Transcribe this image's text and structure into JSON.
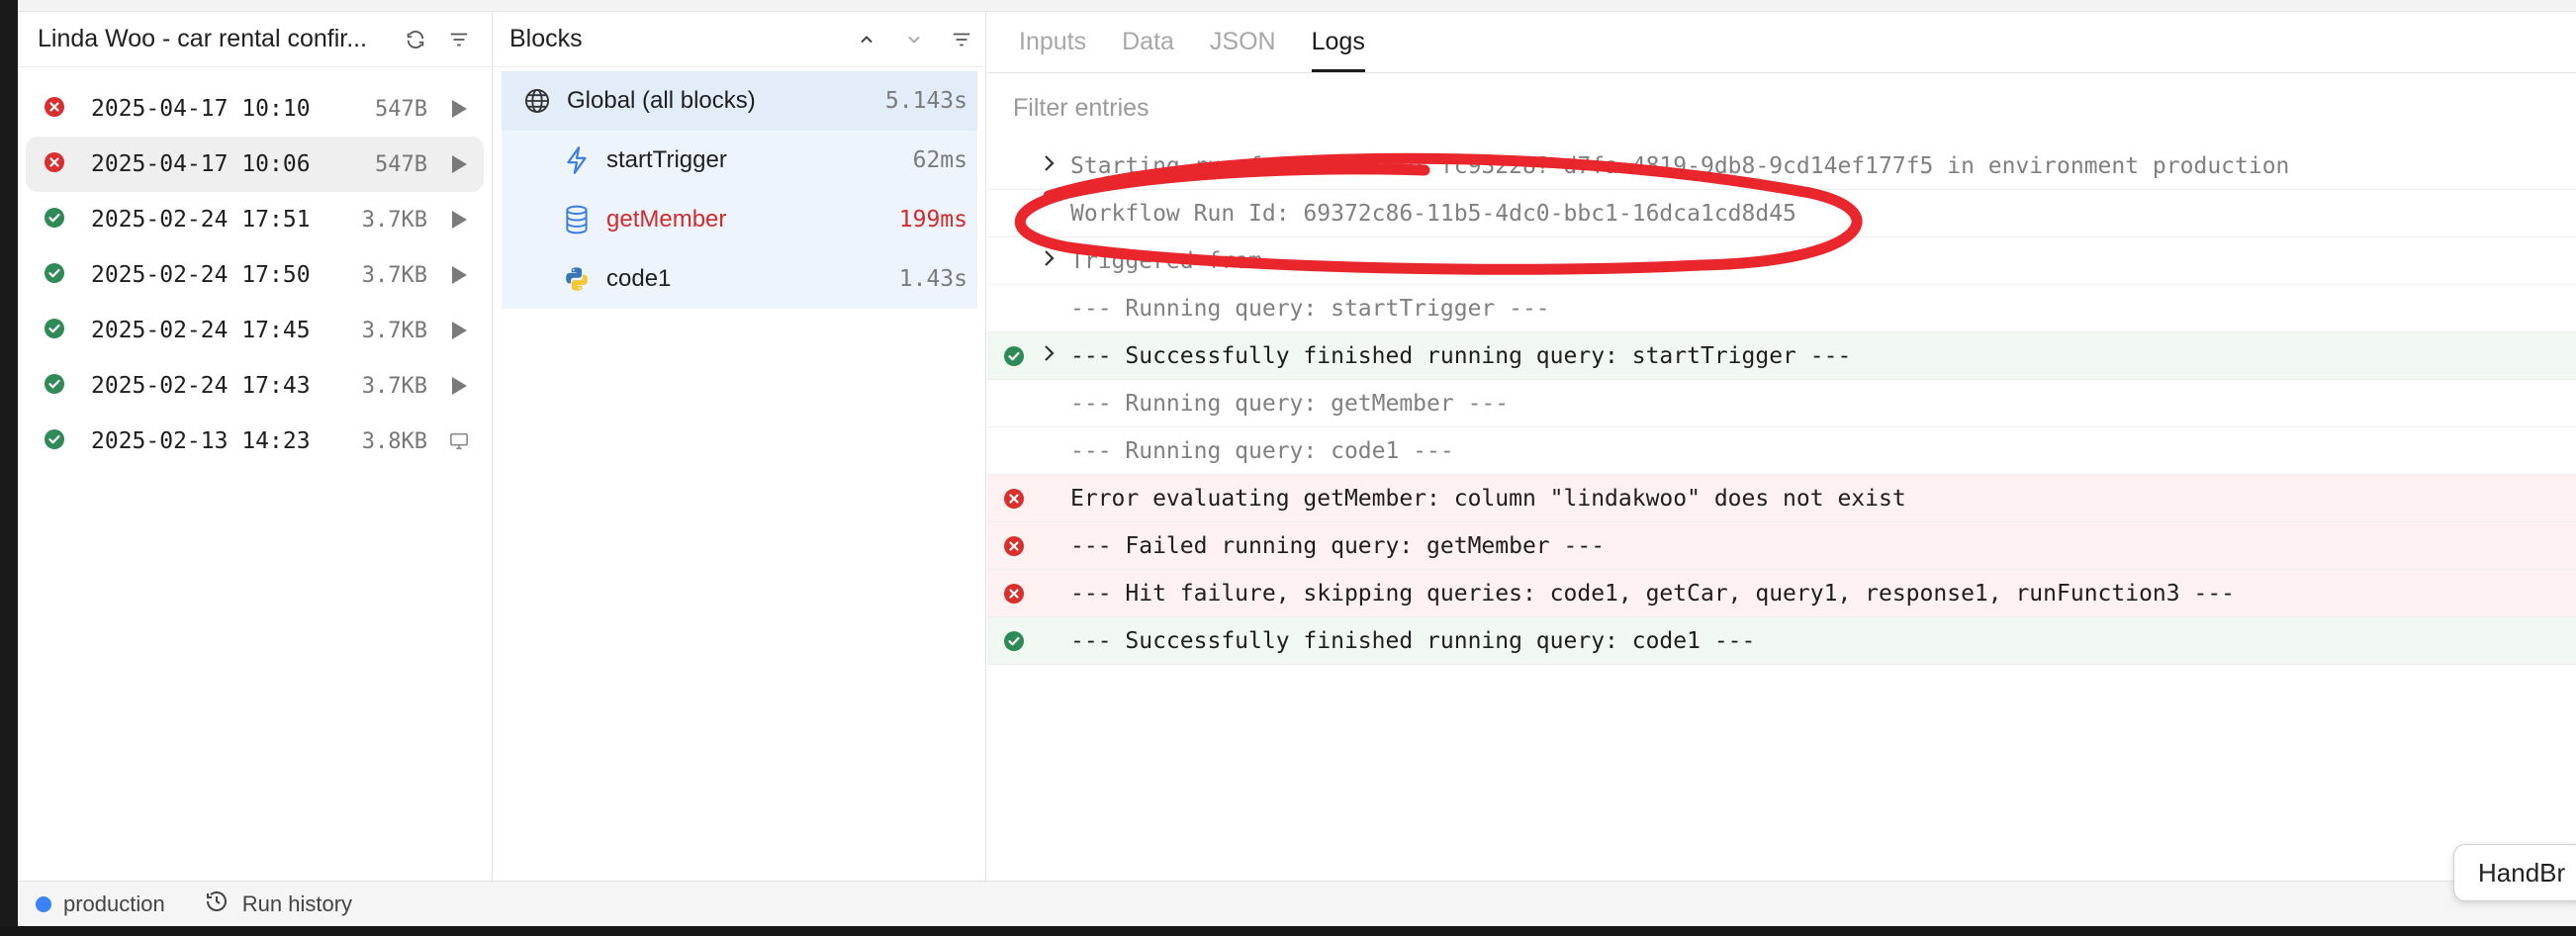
{
  "runs_panel": {
    "title": "Linda Woo - car rental confir...",
    "refresh_icon": "refresh-icon",
    "filter_icon": "filter-icon",
    "runs": [
      {
        "status": "error",
        "time": "2025-04-17 10:10",
        "size": "547B",
        "action": "play"
      },
      {
        "status": "error",
        "time": "2025-04-17 10:06",
        "size": "547B",
        "action": "play",
        "selected": true
      },
      {
        "status": "success",
        "time": "2025-02-24 17:51",
        "size": "3.7KB",
        "action": "play"
      },
      {
        "status": "success",
        "time": "2025-02-24 17:50",
        "size": "3.7KB",
        "action": "play"
      },
      {
        "status": "success",
        "time": "2025-02-24 17:45",
        "size": "3.7KB",
        "action": "play"
      },
      {
        "status": "success",
        "time": "2025-02-24 17:43",
        "size": "3.7KB",
        "action": "play"
      },
      {
        "status": "success",
        "time": "2025-02-13 14:23",
        "size": "3.8KB",
        "action": "monitor"
      }
    ]
  },
  "blocks_panel": {
    "title": "Blocks",
    "blocks": [
      {
        "name": "Global (all blocks)",
        "time": "5.143s",
        "icon": "globe-icon"
      },
      {
        "name": "startTrigger",
        "time": "62ms",
        "icon": "lightning-icon"
      },
      {
        "name": "getMember",
        "time": "199ms",
        "icon": "database-icon",
        "error": true
      },
      {
        "name": "code1",
        "time": "1.43s",
        "icon": "python-icon"
      }
    ]
  },
  "logs_panel": {
    "tabs": [
      "Inputs",
      "Data",
      "JSON",
      "Logs"
    ],
    "active_tab": "Logs",
    "filter_placeholder": "Filter entries",
    "entries": [
      {
        "status": "none",
        "expandable": true,
        "text": "Starting run for workflow: fc93228?-d7fa-4819-9db8-9cd14ef177f5 in environment production",
        "muted": true
      },
      {
        "status": "none",
        "expandable": false,
        "text": "Workflow Run Id: 69372c86-11b5-4dc0-bbc1-16dca1cd8d45",
        "muted": true
      },
      {
        "status": "none",
        "expandable": true,
        "text": "Triggered from ...",
        "muted": true
      },
      {
        "status": "none",
        "expandable": false,
        "text": "--- Running query: startTrigger ---",
        "muted": true
      },
      {
        "status": "success",
        "expandable": true,
        "text": "--- Successfully finished running query: startTrigger ---",
        "muted": false
      },
      {
        "status": "none",
        "expandable": false,
        "text": "--- Running query: getMember ---",
        "muted": true
      },
      {
        "status": "none",
        "expandable": false,
        "text": "--- Running query: code1 ---",
        "muted": true
      },
      {
        "status": "error",
        "expandable": false,
        "text": "Error evaluating getMember: column \"lindakwoo\" does not exist",
        "muted": false
      },
      {
        "status": "error",
        "expandable": false,
        "text": "--- Failed running query: getMember ---",
        "muted": false
      },
      {
        "status": "error",
        "expandable": false,
        "text": "--- Hit failure, skipping queries: code1, getCar, query1, response1, runFunction3 ---",
        "muted": false
      },
      {
        "status": "success",
        "expandable": false,
        "text": "--- Successfully finished running query: code1 ---",
        "muted": false
      }
    ]
  },
  "footer": {
    "environment": "production",
    "history_label": "Run history"
  },
  "dock_tooltip": "HandBr",
  "colors": {
    "error": "#d92f2f",
    "success": "#2e8b57",
    "accent_blue": "#3b82f6",
    "annotation_red": "#e8262c"
  }
}
